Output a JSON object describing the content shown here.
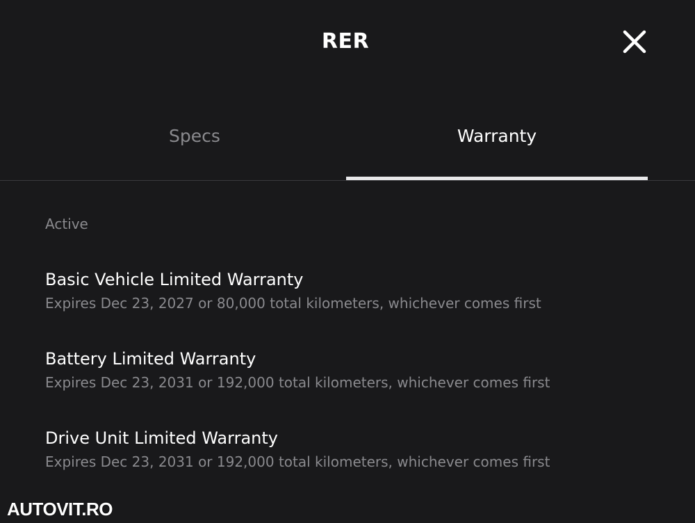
{
  "header": {
    "title": "RER",
    "close_icon": "close-icon"
  },
  "tabs": [
    {
      "label": "Specs",
      "active": false
    },
    {
      "label": "Warranty",
      "active": true
    }
  ],
  "section": {
    "label": "Active"
  },
  "warranties": [
    {
      "title": "Basic Vehicle Limited Warranty",
      "description": "Expires Dec 23, 2027 or 80,000 total kilometers, whichever comes first"
    },
    {
      "title": "Battery Limited Warranty",
      "description": "Expires Dec 23, 2031 or 192,000 total kilometers, whichever comes first"
    },
    {
      "title": "Drive Unit Limited Warranty",
      "description": "Expires Dec 23, 2031 or 192,000 total kilometers, whichever comes first"
    }
  ],
  "watermark": {
    "text": "AUTOVIT.RO"
  },
  "colors": {
    "background": "#19191b",
    "text_primary": "#ffffff",
    "text_secondary": "#8a8a8e",
    "tab_underline": "#e8e8ea",
    "divider": "#3a3a3d"
  }
}
